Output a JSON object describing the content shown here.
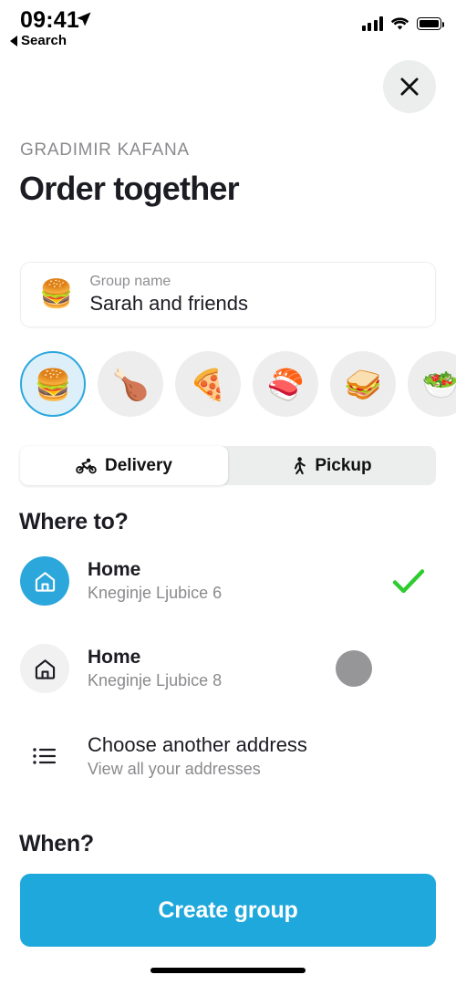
{
  "status_bar": {
    "time": "09:41",
    "back_label": "Search",
    "location_icon": "location-arrow-icon",
    "signal_icon": "cellular-signal-icon",
    "wifi_icon": "wifi-icon",
    "battery_icon": "battery-full-icon"
  },
  "header": {
    "close_icon": "close-icon",
    "eyebrow": "GRADIMIR KAFANA",
    "title": "Order together"
  },
  "group_field": {
    "emoji": "🍔",
    "emoji_name": "hamburger-emoji",
    "label": "Group name",
    "value": "Sarah and friends",
    "placeholder": "Group name"
  },
  "emoji_picker": {
    "options": [
      {
        "emoji": "🍔",
        "name": "hamburger-emoji",
        "selected": true
      },
      {
        "emoji": "🍗",
        "name": "poultry-leg-emoji",
        "selected": false
      },
      {
        "emoji": "🍕",
        "name": "pizza-emoji",
        "selected": false
      },
      {
        "emoji": "🍣",
        "name": "sushi-emoji",
        "selected": false
      },
      {
        "emoji": "🥪",
        "name": "sandwich-emoji",
        "selected": false
      },
      {
        "emoji": "🥗",
        "name": "green-salad-emoji",
        "selected": false
      }
    ]
  },
  "mode_toggle": {
    "options": [
      {
        "label": "Delivery",
        "icon": "bicycle-icon",
        "selected": true
      },
      {
        "label": "Pickup",
        "icon": "walking-person-icon",
        "selected": false
      }
    ]
  },
  "where_section": {
    "heading": "Where to?",
    "addresses": [
      {
        "title": "Home",
        "subtitle": "Kneginje Ljubice 6",
        "icon": "home-icon",
        "state": "selected"
      },
      {
        "title": "Home",
        "subtitle": "Kneginje Ljubice 8",
        "icon": "home-icon",
        "state": "loading"
      },
      {
        "title": "Choose another address",
        "subtitle": "View all your addresses",
        "icon": "list-icon",
        "state": "none"
      }
    ]
  },
  "when_section": {
    "heading": "When?"
  },
  "cta": {
    "label": "Create group"
  },
  "colors": {
    "accent_blue": "#1fa8dc",
    "icon_blue": "#2ba7dc",
    "selected_ring": "#2ca8dd",
    "selected_fill": "#ddf0fa",
    "check_green": "#2ecc2e",
    "chip_gray": "#ededee",
    "dot_gray": "#969698",
    "muted_text": "#8a8a8e",
    "title_text": "#1c1c23"
  }
}
